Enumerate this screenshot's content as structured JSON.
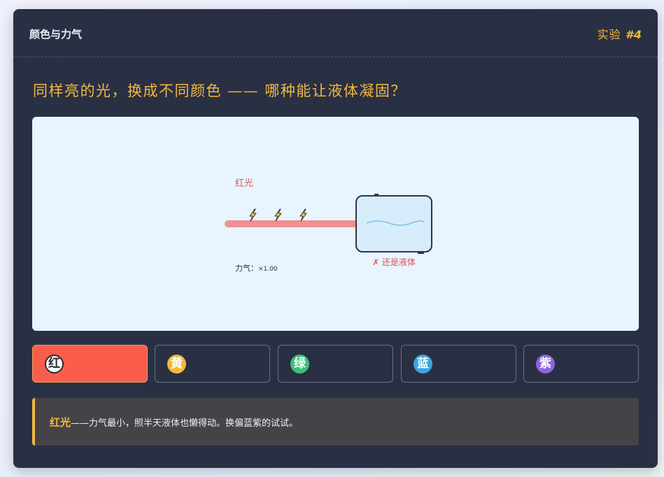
{
  "header": {
    "title": "颜色与力气",
    "experiment_prefix": "实验 ",
    "experiment_number": "#4"
  },
  "question": "同样亮的光，换成不同颜色 —— 哪种能让液体凝固？",
  "stage": {
    "light_label": "红光",
    "light_color": "#f09090",
    "bolt_icon": "lightning-bolt-icon",
    "power_label": "力气：",
    "power_value": "×1.00",
    "result": "✗ 还是液体",
    "result_color": "#e84c4c",
    "liquid_color": "#d7ecfb"
  },
  "options": [
    {
      "key": "red",
      "char": "红",
      "color": "#fb5d4c",
      "selected": true
    },
    {
      "key": "yellow",
      "char": "黄",
      "color": "#f5b93a",
      "selected": false
    },
    {
      "key": "green",
      "char": "绿",
      "color": "#3fbf7a",
      "selected": false
    },
    {
      "key": "blue",
      "char": "蓝",
      "color": "#3aa5e0",
      "selected": false
    },
    {
      "key": "purple",
      "char": "紫",
      "color": "#8d64e0",
      "selected": false
    }
  ],
  "tip": {
    "highlight": "红光",
    "text": "——力气最小，照半天液体也懒得动。换偏蓝紫的试试。"
  }
}
